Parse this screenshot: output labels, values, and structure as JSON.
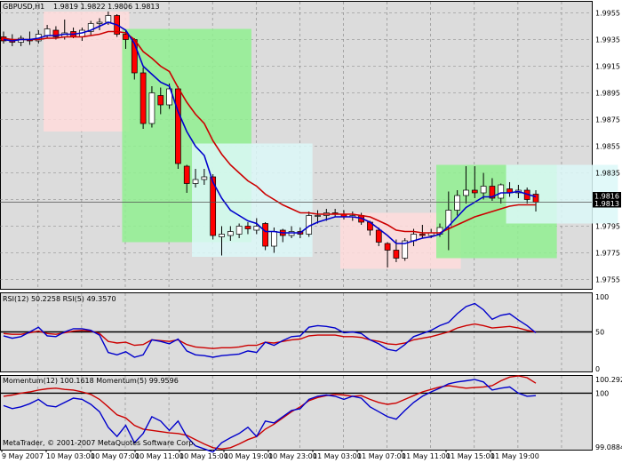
{
  "chart_data": [
    {
      "type": "candlestick",
      "symbol_label": "GBPUSD,H1",
      "ohlc_label": "1.9819 1.9822 1.9806 1.9813",
      "y_ticks": [
        "1.9955",
        "1.9935",
        "1.9915",
        "1.9895",
        "1.9875",
        "1.9855",
        "1.9835",
        "1.9815",
        "1.9795",
        "1.9775",
        "1.9755"
      ],
      "price_tags": [
        "1.9816",
        "1.9813"
      ],
      "ylim": [
        1.9748,
        1.9964
      ],
      "candles": [
        {
          "o": 1.9937,
          "h": 1.9941,
          "l": 1.9932,
          "c": 1.9934
        },
        {
          "o": 1.9935,
          "h": 1.9939,
          "l": 1.993,
          "c": 1.9933
        },
        {
          "o": 1.9933,
          "h": 1.9938,
          "l": 1.993,
          "c": 1.9936
        },
        {
          "o": 1.9935,
          "h": 1.9941,
          "l": 1.9931,
          "c": 1.9934
        },
        {
          "o": 1.9934,
          "h": 1.9942,
          "l": 1.9932,
          "c": 1.9939
        },
        {
          "o": 1.9938,
          "h": 1.9946,
          "l": 1.9936,
          "c": 1.9943
        },
        {
          "o": 1.9942,
          "h": 1.9945,
          "l": 1.9935,
          "c": 1.9937
        },
        {
          "o": 1.9937,
          "h": 1.995,
          "l": 1.9935,
          "c": 1.994
        },
        {
          "o": 1.9941,
          "h": 1.9944,
          "l": 1.9936,
          "c": 1.9937
        },
        {
          "o": 1.9937,
          "h": 1.9944,
          "l": 1.9934,
          "c": 1.9942
        },
        {
          "o": 1.9941,
          "h": 1.9949,
          "l": 1.9938,
          "c": 1.9947
        },
        {
          "o": 1.9947,
          "h": 1.9951,
          "l": 1.9942,
          "c": 1.9948
        },
        {
          "o": 1.9948,
          "h": 1.9956,
          "l": 1.9946,
          "c": 1.9953
        },
        {
          "o": 1.9953,
          "h": 1.9954,
          "l": 1.9937,
          "c": 1.9939
        },
        {
          "o": 1.9939,
          "h": 1.9942,
          "l": 1.9928,
          "c": 1.9935
        },
        {
          "o": 1.9935,
          "h": 1.9936,
          "l": 1.9905,
          "c": 1.991
        },
        {
          "o": 1.991,
          "h": 1.9914,
          "l": 1.9868,
          "c": 1.9872
        },
        {
          "o": 1.9872,
          "h": 1.99,
          "l": 1.9869,
          "c": 1.9895
        },
        {
          "o": 1.9893,
          "h": 1.9899,
          "l": 1.9879,
          "c": 1.9886
        },
        {
          "o": 1.9886,
          "h": 1.9902,
          "l": 1.9883,
          "c": 1.9898
        },
        {
          "o": 1.9898,
          "h": 1.99,
          "l": 1.9838,
          "c": 1.9842
        },
        {
          "o": 1.984,
          "h": 1.9841,
          "l": 1.982,
          "c": 1.9827
        },
        {
          "o": 1.9827,
          "h": 1.9838,
          "l": 1.9824,
          "c": 1.983
        },
        {
          "o": 1.983,
          "h": 1.9838,
          "l": 1.9826,
          "c": 1.9832
        },
        {
          "o": 1.9832,
          "h": 1.9834,
          "l": 1.9785,
          "c": 1.9788
        },
        {
          "o": 1.9787,
          "h": 1.9795,
          "l": 1.9773,
          "c": 1.9789
        },
        {
          "o": 1.9788,
          "h": 1.9795,
          "l": 1.9784,
          "c": 1.9791
        },
        {
          "o": 1.9789,
          "h": 1.9797,
          "l": 1.9786,
          "c": 1.9795
        },
        {
          "o": 1.9795,
          "h": 1.9798,
          "l": 1.9789,
          "c": 1.9793
        },
        {
          "o": 1.9792,
          "h": 1.9801,
          "l": 1.9789,
          "c": 1.9795
        },
        {
          "o": 1.9797,
          "h": 1.9798,
          "l": 1.9777,
          "c": 1.978
        },
        {
          "o": 1.978,
          "h": 1.9794,
          "l": 1.9775,
          "c": 1.9791
        },
        {
          "o": 1.9792,
          "h": 1.9793,
          "l": 1.9783,
          "c": 1.9788
        },
        {
          "o": 1.9788,
          "h": 1.9795,
          "l": 1.9786,
          "c": 1.9791
        },
        {
          "o": 1.9791,
          "h": 1.9794,
          "l": 1.9786,
          "c": 1.9789
        },
        {
          "o": 1.9789,
          "h": 1.9806,
          "l": 1.9787,
          "c": 1.9803
        },
        {
          "o": 1.9803,
          "h": 1.9807,
          "l": 1.9797,
          "c": 1.9803
        },
        {
          "o": 1.9803,
          "h": 1.9808,
          "l": 1.9799,
          "c": 1.9805
        },
        {
          "o": 1.9805,
          "h": 1.9808,
          "l": 1.9802,
          "c": 1.9804
        },
        {
          "o": 1.9804,
          "h": 1.9807,
          "l": 1.98,
          "c": 1.9802
        },
        {
          "o": 1.9802,
          "h": 1.9806,
          "l": 1.9799,
          "c": 1.9803
        },
        {
          "o": 1.9803,
          "h": 1.9805,
          "l": 1.9796,
          "c": 1.9798
        },
        {
          "o": 1.9798,
          "h": 1.9799,
          "l": 1.9788,
          "c": 1.9792
        },
        {
          "o": 1.9792,
          "h": 1.9794,
          "l": 1.978,
          "c": 1.9783
        },
        {
          "o": 1.9782,
          "h": 1.9783,
          "l": 1.9764,
          "c": 1.9777
        },
        {
          "o": 1.9777,
          "h": 1.9785,
          "l": 1.9768,
          "c": 1.9771
        },
        {
          "o": 1.9771,
          "h": 1.9786,
          "l": 1.9769,
          "c": 1.9784
        },
        {
          "o": 1.9784,
          "h": 1.9793,
          "l": 1.978,
          "c": 1.9789
        },
        {
          "o": 1.9789,
          "h": 1.9796,
          "l": 1.9786,
          "c": 1.9788
        },
        {
          "o": 1.9788,
          "h": 1.9793,
          "l": 1.9786,
          "c": 1.979
        },
        {
          "o": 1.9789,
          "h": 1.9797,
          "l": 1.9787,
          "c": 1.9794
        },
        {
          "o": 1.9794,
          "h": 1.9821,
          "l": 1.9777,
          "c": 1.9807
        },
        {
          "o": 1.9807,
          "h": 1.9822,
          "l": 1.9803,
          "c": 1.9818
        },
        {
          "o": 1.9818,
          "h": 1.984,
          "l": 1.9812,
          "c": 1.9822
        },
        {
          "o": 1.9822,
          "h": 1.984,
          "l": 1.9816,
          "c": 1.982
        },
        {
          "o": 1.982,
          "h": 1.9835,
          "l": 1.9815,
          "c": 1.9825
        },
        {
          "o": 1.9825,
          "h": 1.9831,
          "l": 1.9814,
          "c": 1.9816
        },
        {
          "o": 1.9816,
          "h": 1.9827,
          "l": 1.9812,
          "c": 1.9826
        },
        {
          "o": 1.9823,
          "h": 1.9828,
          "l": 1.9817,
          "c": 1.982
        },
        {
          "o": 1.982,
          "h": 1.9826,
          "l": 1.9816,
          "c": 1.9822
        },
        {
          "o": 1.9822,
          "h": 1.9824,
          "l": 1.9812,
          "c": 1.9815
        },
        {
          "o": 1.9819,
          "h": 1.9822,
          "l": 1.9806,
          "c": 1.9813
        }
      ],
      "ma_fast": [
        1.9935,
        1.9934,
        1.9935,
        1.9935,
        1.9936,
        1.9938,
        1.9938,
        1.9939,
        1.9939,
        1.994,
        1.9942,
        1.9945,
        1.9948,
        1.9946,
        1.9942,
        1.9932,
        1.9915,
        1.9909,
        1.9903,
        1.99,
        1.9881,
        1.9866,
        1.9855,
        1.9848,
        1.9828,
        1.9816,
        1.9807,
        1.9803,
        1.9799,
        1.9797,
        1.9791,
        1.9791,
        1.979,
        1.979,
        1.979,
        1.9795,
        1.9798,
        1.98,
        1.9802,
        1.9802,
        1.9802,
        1.9801,
        1.9798,
        1.9793,
        1.9788,
        1.9782,
        1.9782,
        1.9784,
        1.9786,
        1.9787,
        1.9789,
        1.9795,
        1.9802,
        1.9809,
        1.9813,
        1.9817,
        1.9817,
        1.982,
        1.982,
        1.9821,
        1.9819,
        1.9817
      ],
      "ma_slow": [
        1.9936,
        1.9935,
        1.9935,
        1.9935,
        1.9935,
        1.9936,
        1.9936,
        1.9937,
        1.9937,
        1.9937,
        1.9938,
        1.9939,
        1.9941,
        1.9941,
        1.994,
        1.9935,
        1.9926,
        1.9921,
        1.9915,
        1.9911,
        1.9899,
        1.9888,
        1.9879,
        1.9872,
        1.9859,
        1.9849,
        1.9841,
        1.9835,
        1.9829,
        1.9825,
        1.9819,
        1.9815,
        1.9811,
        1.9808,
        1.9805,
        1.9805,
        1.9804,
        1.9804,
        1.9804,
        1.9804,
        1.9804,
        1.9803,
        1.9802,
        1.9799,
        1.9796,
        1.9792,
        1.9791,
        1.9791,
        1.979,
        1.979,
        1.979,
        1.9793,
        1.9796,
        1.9799,
        1.9802,
        1.9804,
        1.9806,
        1.9808,
        1.981,
        1.9811,
        1.9811,
        1.9811
      ],
      "zones": [
        {
          "from": 5,
          "to": 14,
          "top": 1.9956,
          "bottom": 1.9866,
          "fill": "#ffdcdc"
        },
        {
          "from": 14,
          "to": 28,
          "top": 1.9943,
          "bottom": 1.9783,
          "fill": "#90f090"
        },
        {
          "from": 22,
          "to": 35,
          "top": 1.9857,
          "bottom": 1.9772,
          "fill": "#dcf8f8"
        },
        {
          "from": 39,
          "to": 52,
          "top": 1.9805,
          "bottom": 1.9763,
          "fill": "#ffdcdc"
        },
        {
          "from": 50,
          "to": 63,
          "top": 1.9841,
          "bottom": 1.9771,
          "fill": "#90f090"
        },
        {
          "from": 58,
          "to": 70,
          "top": 1.9841,
          "bottom": 1.9797,
          "fill": "#dcf8f8"
        }
      ],
      "colors": {
        "bull": "#ffffff",
        "bear": "#ff0000",
        "line_fast": "#0000cc",
        "line_slow": "#cc0000",
        "grid": "#808080"
      }
    },
    {
      "type": "line",
      "label": "RSI(12) 50.2258  RSI(5) 49.3570",
      "y_ticks": [
        "100",
        "50",
        "0"
      ],
      "ylim": [
        0,
        100
      ],
      "level": 50,
      "series_fast": [
        45,
        42,
        44,
        50,
        56,
        45,
        44,
        50,
        54,
        54,
        52,
        46,
        24,
        21,
        25,
        18,
        21,
        40,
        38,
        35,
        41,
        26,
        21,
        20,
        18,
        20,
        21,
        22,
        26,
        24,
        37,
        33,
        39,
        44,
        45,
        56,
        58,
        57,
        55,
        49,
        50,
        48,
        40,
        35,
        28,
        26,
        34,
        44,
        48,
        52,
        58,
        62,
        73,
        82,
        86,
        78,
        66,
        71,
        73,
        65,
        58,
        49
      ],
      "series_slow": [
        48,
        47,
        47,
        49,
        51,
        48,
        47,
        49,
        51,
        52,
        51,
        48,
        38,
        36,
        37,
        33,
        34,
        40,
        39,
        38,
        40,
        34,
        31,
        30,
        29,
        30,
        30,
        31,
        33,
        33,
        37,
        36,
        38,
        40,
        41,
        45,
        46,
        46,
        46,
        44,
        44,
        43,
        40,
        38,
        35,
        34,
        36,
        40,
        42,
        44,
        47,
        50,
        55,
        58,
        60,
        58,
        55,
        56,
        57,
        55,
        52,
        50
      ],
      "colors": {
        "fast": "#0000cc",
        "slow": "#cc0000",
        "level": "#000000"
      }
    },
    {
      "type": "line",
      "label": "Momentum(12) 100.1618  Momentum(5) 99.9596",
      "y_ticks": [
        "100.2925",
        "100",
        "99.0884"
      ],
      "ylim": [
        99.0884,
        100.2925
      ],
      "level": 100,
      "series_fast": [
        99.8,
        99.75,
        99.78,
        99.83,
        99.9,
        99.8,
        99.78,
        99.85,
        99.92,
        99.9,
        99.82,
        99.7,
        99.45,
        99.3,
        99.48,
        99.2,
        99.35,
        99.62,
        99.55,
        99.4,
        99.55,
        99.3,
        99.15,
        99.1,
        99.05,
        99.2,
        99.28,
        99.35,
        99.45,
        99.3,
        99.55,
        99.52,
        99.62,
        99.72,
        99.75,
        99.9,
        99.95,
        99.97,
        99.95,
        99.9,
        99.95,
        99.92,
        99.78,
        99.7,
        99.62,
        99.58,
        99.72,
        99.85,
        99.95,
        100.02,
        100.08,
        100.15,
        100.18,
        100.2,
        100.22,
        100.18,
        100.05,
        100.08,
        100.1,
        100.0,
        99.95,
        99.96
      ],
      "series_slow": [
        99.95,
        99.97,
        100.0,
        100.02,
        100.05,
        100.07,
        100.08,
        100.06,
        100.05,
        100.02,
        99.98,
        99.9,
        99.78,
        99.65,
        99.6,
        99.48,
        99.42,
        99.4,
        99.38,
        99.36,
        99.35,
        99.32,
        99.25,
        99.18,
        99.12,
        99.1,
        99.12,
        99.18,
        99.25,
        99.3,
        99.42,
        99.5,
        99.6,
        99.7,
        99.78,
        99.88,
        99.93,
        99.96,
        99.98,
        99.97,
        99.95,
        99.96,
        99.9,
        99.85,
        99.82,
        99.84,
        99.9,
        99.96,
        100.02,
        100.06,
        100.1,
        100.12,
        100.1,
        100.08,
        100.09,
        100.1,
        100.12,
        100.2,
        100.26,
        100.28,
        100.25,
        100.16
      ],
      "colors": {
        "fast": "#0000cc",
        "slow": "#cc0000",
        "level": "#000000"
      }
    }
  ],
  "x_labels": [
    "9 May 2007",
    "10 May 03:00",
    "10 May 07:00",
    "10 May 11:00",
    "10 May 15:00",
    "10 May 19:00",
    "10 May 23:00",
    "11 May 03:00",
    "11 May 07:00",
    "11 May 11:00",
    "11 May 15:00",
    "11 May 19:00"
  ],
  "footer": "MetaTrader, © 2001-2007 MetaQuotes Software Corp."
}
